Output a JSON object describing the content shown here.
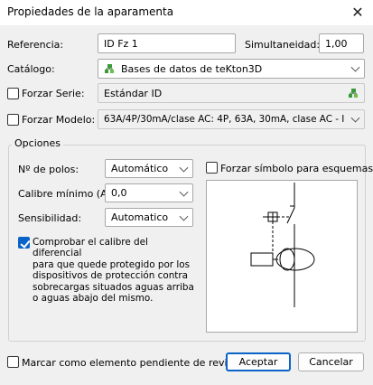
{
  "window": {
    "title": "Propiedades de la aparamenta",
    "close_glyph": "✕"
  },
  "referencia": {
    "label": "Referencia:",
    "value": "ID Fz 1"
  },
  "simultaneidad": {
    "label": "Simultaneidad:",
    "value": "1,00"
  },
  "catalogo": {
    "label": "Catálogo:",
    "value": "Bases de datos de teKton3D",
    "icon": "database-tree-icon"
  },
  "forzar_serie": {
    "label": "Forzar Serie:",
    "checked": false,
    "value": "Estándar ID",
    "icon": "database-tree-icon"
  },
  "forzar_modelo": {
    "label": "Forzar Modelo:",
    "checked": false,
    "value": "63A/4P/30mA/clase AC: 4P, 63A, 30mA, clase AC - I"
  },
  "opciones": {
    "title": "Opciones",
    "polos": {
      "label": "Nº de polos:",
      "value": "Automático"
    },
    "calibre": {
      "label": "Calibre mínimo (A):",
      "value": "0,0"
    },
    "sensibilidad": {
      "label": "Sensibilidad:",
      "value": "Automatico"
    },
    "comprobar": {
      "checked": true,
      "lines": [
        "Comprobar el calibre del diferencial",
        "para que quede protegido por los",
        "dispositivos de protección contra",
        "sobrecargas situados aguas arriba",
        "o aguas abajo del mismo."
      ]
    },
    "forzar_simbolo": {
      "label": "Forzar símbolo para esquemas:",
      "checked": false
    }
  },
  "footer": {
    "marcar": {
      "label": "Marcar como elemento pendiente de revisión.",
      "checked": false
    },
    "aceptar": "Aceptar",
    "cancelar": "Cancelar"
  },
  "colors": {
    "accent": "#0a64c8",
    "icon_green": "#3a9a3a"
  }
}
